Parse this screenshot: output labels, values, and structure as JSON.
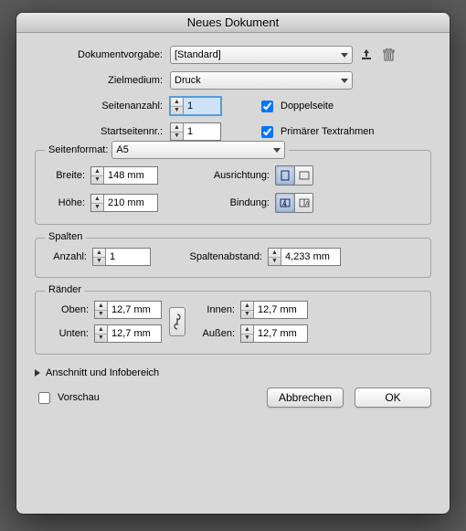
{
  "title": "Neues Dokument",
  "labels": {
    "preset": "Dokumentvorgabe:",
    "intent": "Zielmedium:",
    "pagecount": "Seitenanzahl:",
    "startpage": "Startseitennr.:",
    "facing": "Doppelseite",
    "primaryframe": "Primärer Textrahmen",
    "pageformat": "Seitenformat:",
    "width": "Breite:",
    "height": "Höhe:",
    "orientation": "Ausrichtung:",
    "binding": "Bindung:",
    "columns": "Spalten",
    "colcount": "Anzahl:",
    "colgap": "Spaltenabstand:",
    "margins": "Ränder",
    "top": "Oben:",
    "bottom": "Unten:",
    "inner": "Innen:",
    "outer": "Außen:",
    "bleed": "Anschnitt und Infobereich",
    "preview": "Vorschau",
    "cancel": "Abbrechen",
    "ok": "OK"
  },
  "values": {
    "preset": "[Standard]",
    "intent": "Druck",
    "pagecount": "1",
    "startpage": "1",
    "facing": true,
    "primaryframe": true,
    "pageformat": "A5",
    "width": "148 mm",
    "height": "210 mm",
    "colcount": "1",
    "colgap": "4,233 mm",
    "top": "12,7 mm",
    "bottom": "12,7 mm",
    "inner": "12,7 mm",
    "outer": "12,7 mm",
    "preview": false
  }
}
